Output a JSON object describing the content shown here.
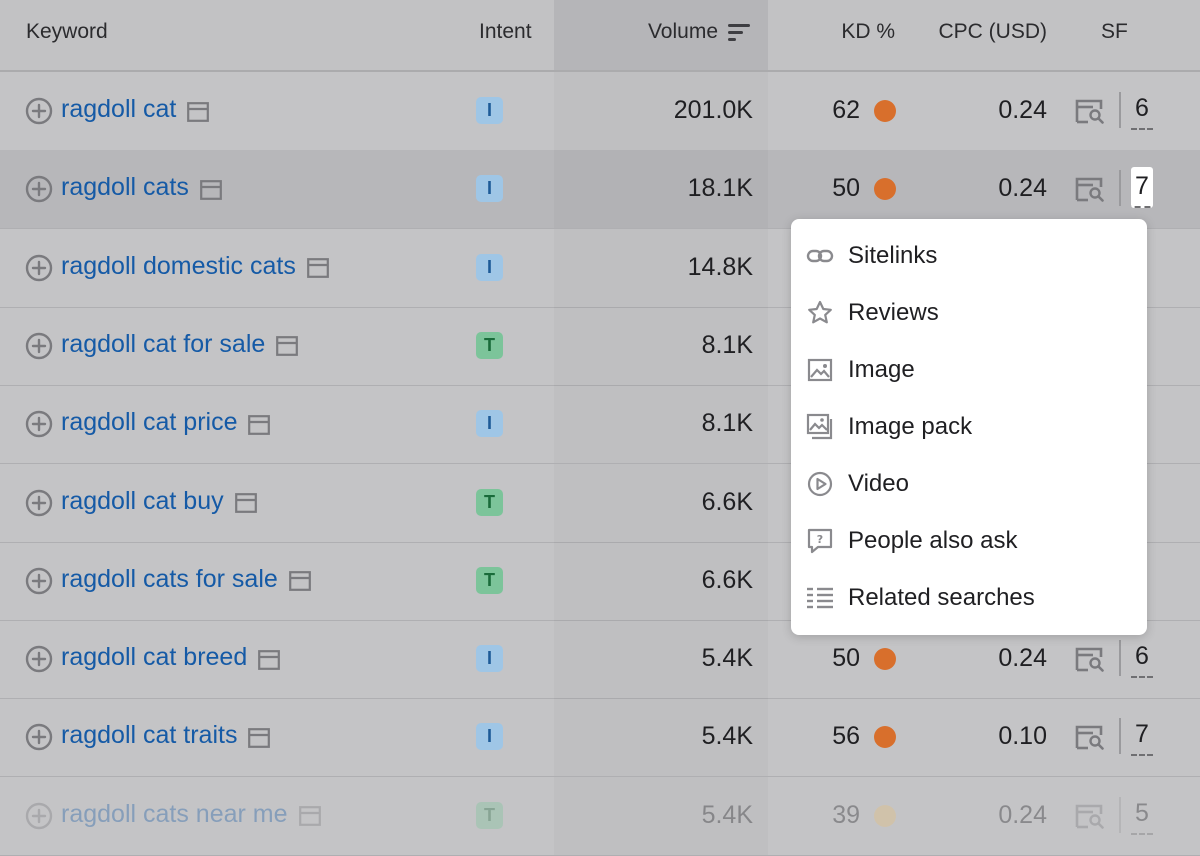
{
  "header": {
    "keyword": "Keyword",
    "intent": "Intent",
    "volume": "Volume",
    "kd": "KD %",
    "cpc": "CPC (USD)",
    "sf": "SF"
  },
  "rows": [
    {
      "keyword": "ragdoll cat",
      "intent": "I",
      "volume": "201.0K",
      "kd": "62",
      "cpc": "0.24",
      "sf": "6"
    },
    {
      "keyword": "ragdoll cats",
      "intent": "I",
      "volume": "18.1K",
      "kd": "50",
      "cpc": "0.24",
      "sf": "7"
    },
    {
      "keyword": "ragdoll domestic cats",
      "intent": "I",
      "volume": "14.8K"
    },
    {
      "keyword": "ragdoll cat for sale",
      "intent": "T",
      "volume": "8.1K"
    },
    {
      "keyword": "ragdoll cat price",
      "intent": "I",
      "volume": "8.1K"
    },
    {
      "keyword": "ragdoll cat buy",
      "intent": "T",
      "volume": "6.6K"
    },
    {
      "keyword": "ragdoll cats for sale",
      "intent": "T",
      "volume": "6.6K"
    },
    {
      "keyword": "ragdoll cat breed",
      "intent": "I",
      "volume": "5.4K",
      "kd": "50",
      "cpc": "0.24",
      "sf": "6"
    },
    {
      "keyword": "ragdoll cat traits",
      "intent": "I",
      "volume": "5.4K",
      "kd": "56",
      "cpc": "0.10",
      "sf": "7"
    },
    {
      "keyword": "ragdoll cats near me",
      "intent": "T",
      "volume": "5.4K",
      "kd": "39",
      "cpc": "0.24",
      "sf": "5"
    }
  ],
  "serp_features_popup": {
    "items": [
      {
        "label": "Sitelinks",
        "icon": "link-icon"
      },
      {
        "label": "Reviews",
        "icon": "star-icon"
      },
      {
        "label": "Image",
        "icon": "image-icon"
      },
      {
        "label": "Image pack",
        "icon": "image-pack-icon"
      },
      {
        "label": "Video",
        "icon": "video-icon"
      },
      {
        "label": "People also ask",
        "icon": "question-icon"
      },
      {
        "label": "Related searches",
        "icon": "list-icon"
      }
    ]
  },
  "colors": {
    "keyword_link": "#155aa6",
    "intent_informational": "#9fc6e6",
    "intent_transactional": "#7cc49a",
    "kd_dot": "#d86f2c"
  }
}
